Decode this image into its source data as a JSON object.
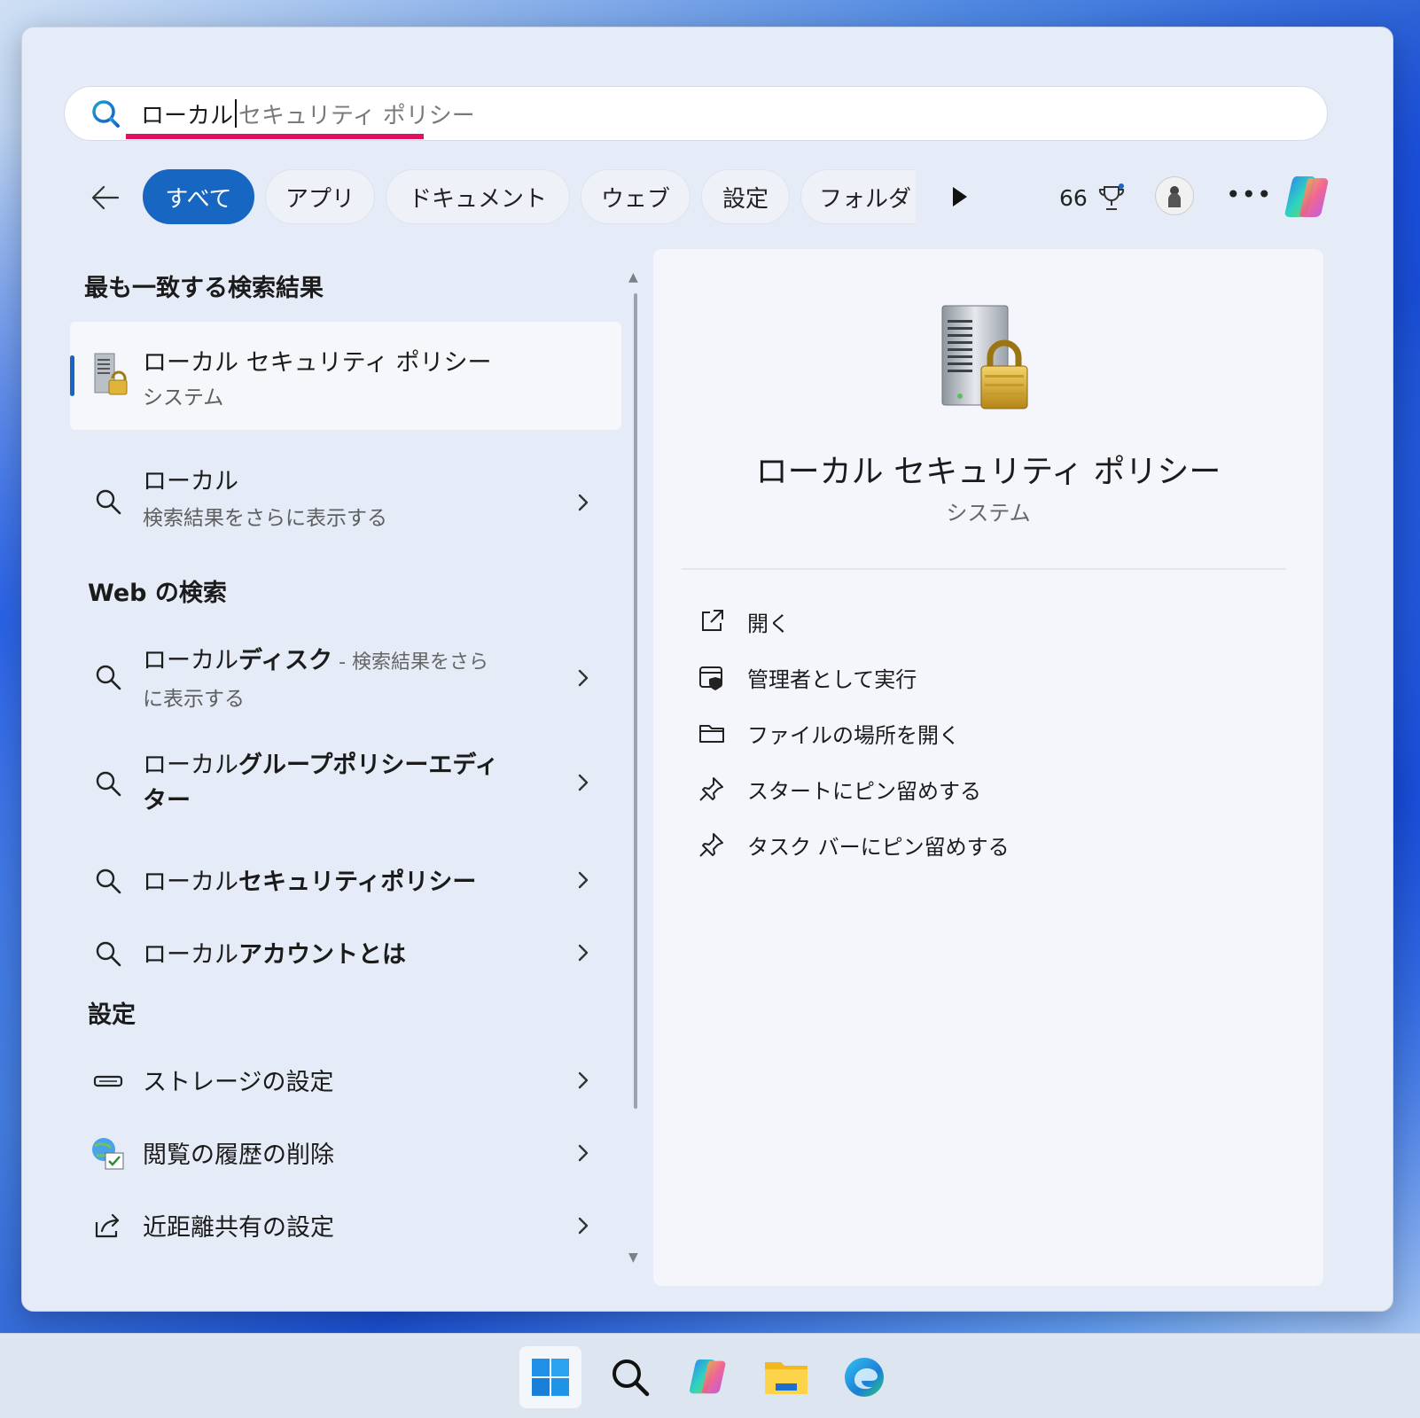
{
  "search": {
    "typed": "ローカル",
    "suggestion": "セキュリティ ポリシー"
  },
  "filters": {
    "items": [
      "すべて",
      "アプリ",
      "ドキュメント",
      "ウェブ",
      "設定",
      "フォルダ"
    ],
    "active_index": 0,
    "points": "66"
  },
  "left": {
    "best_match_heading": "最も一致する検索結果",
    "best_match": {
      "title": "ローカル セキュリティ ポリシー",
      "subtitle": "システム"
    },
    "more_results": {
      "title": "ローカル",
      "subtitle": "検索結果をさらに表示する"
    },
    "web_heading": "Web の検索",
    "web_items": [
      {
        "prefix": "ローカル",
        "bold": "ディスク",
        "suffix": " - 検索結果をさら",
        "line2": "に表示する"
      },
      {
        "prefix": "ローカル",
        "bold": "グループポリシーエディ",
        "line2": "ター"
      },
      {
        "prefix": "ローカル",
        "bold": "セキュリティポリシー"
      },
      {
        "prefix": "ローカル",
        "bold": "アカウントとは"
      }
    ],
    "settings_heading": "設定",
    "settings_items": [
      {
        "label": "ストレージの設定",
        "icon": "storage-icon"
      },
      {
        "label": "閲覧の履歴の削除",
        "icon": "internet-options-icon"
      },
      {
        "label": "近距離共有の設定",
        "icon": "share-icon"
      }
    ]
  },
  "detail": {
    "title": "ローカル セキュリティ ポリシー",
    "subtitle": "システム",
    "actions": [
      {
        "label": "開く",
        "icon": "open-external-icon"
      },
      {
        "label": "管理者として実行",
        "icon": "run-as-admin-icon"
      },
      {
        "label": "ファイルの場所を開く",
        "icon": "folder-icon"
      },
      {
        "label": "スタートにピン留めする",
        "icon": "pin-icon"
      },
      {
        "label": "タスク バーにピン留めする",
        "icon": "pin-icon"
      }
    ]
  },
  "colors": {
    "accent": "#1766c2",
    "underline": "#e0115f"
  }
}
